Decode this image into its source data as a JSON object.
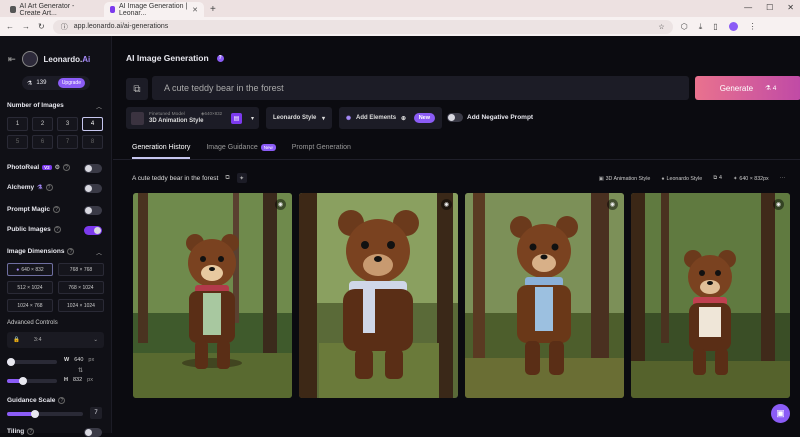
{
  "browser": {
    "tabs": [
      {
        "title": "AI Art Generator - Create Art..."
      },
      {
        "title": "AI Image Generation | Leonar..."
      }
    ],
    "url": "app.leonardo.ai/ai-generations"
  },
  "sidebar": {
    "brand": "Leonardo.",
    "brand_suffix": "Ai",
    "tokens": "139",
    "upgrade": "Upgrade",
    "num_images_title": "Number of Images",
    "num_options": [
      "1",
      "2",
      "3",
      "4",
      "5",
      "6",
      "7",
      "8"
    ],
    "num_selected": "4",
    "photoreal": "PhotoReal",
    "photoreal_badge": "V2",
    "alchemy": "Alchemy",
    "prompt_magic": "Prompt Magic",
    "public_images": "Public Images",
    "image_dimensions": "Image Dimensions",
    "dims": [
      "640 × 832",
      "768 × 768",
      "512 × 1024",
      "768 × 1024",
      "1024 × 768",
      "1024 × 1024"
    ],
    "advanced": "Advanced Controls",
    "ratio": "3:4",
    "width_label": "W",
    "width": "640",
    "height_label": "H",
    "height": "832",
    "unit": "px",
    "guidance": "Guidance Scale",
    "guidance_value": "7",
    "tiling": "Tiling"
  },
  "main": {
    "title": "AI Image Generation",
    "prompt": "A cute teddy bear in the forest",
    "generate": "Generate",
    "generate_cost": "4",
    "model_tag": "Finetuned Model",
    "model_dims": "640×832",
    "model_name": "3D Animation Style",
    "style": "Leonardo Style",
    "add_elements": "Add Elements",
    "new": "New",
    "negative": "Add Negative Prompt",
    "tabs": [
      "Generation History",
      "Image Guidance",
      "Prompt Generation"
    ],
    "tab_new": "New",
    "row_prompt": "A cute teddy bear in the forest",
    "row_model": "3D Animation Style",
    "row_style": "Leonardo Style",
    "row_count": "4",
    "row_dims": "640 × 832px"
  }
}
